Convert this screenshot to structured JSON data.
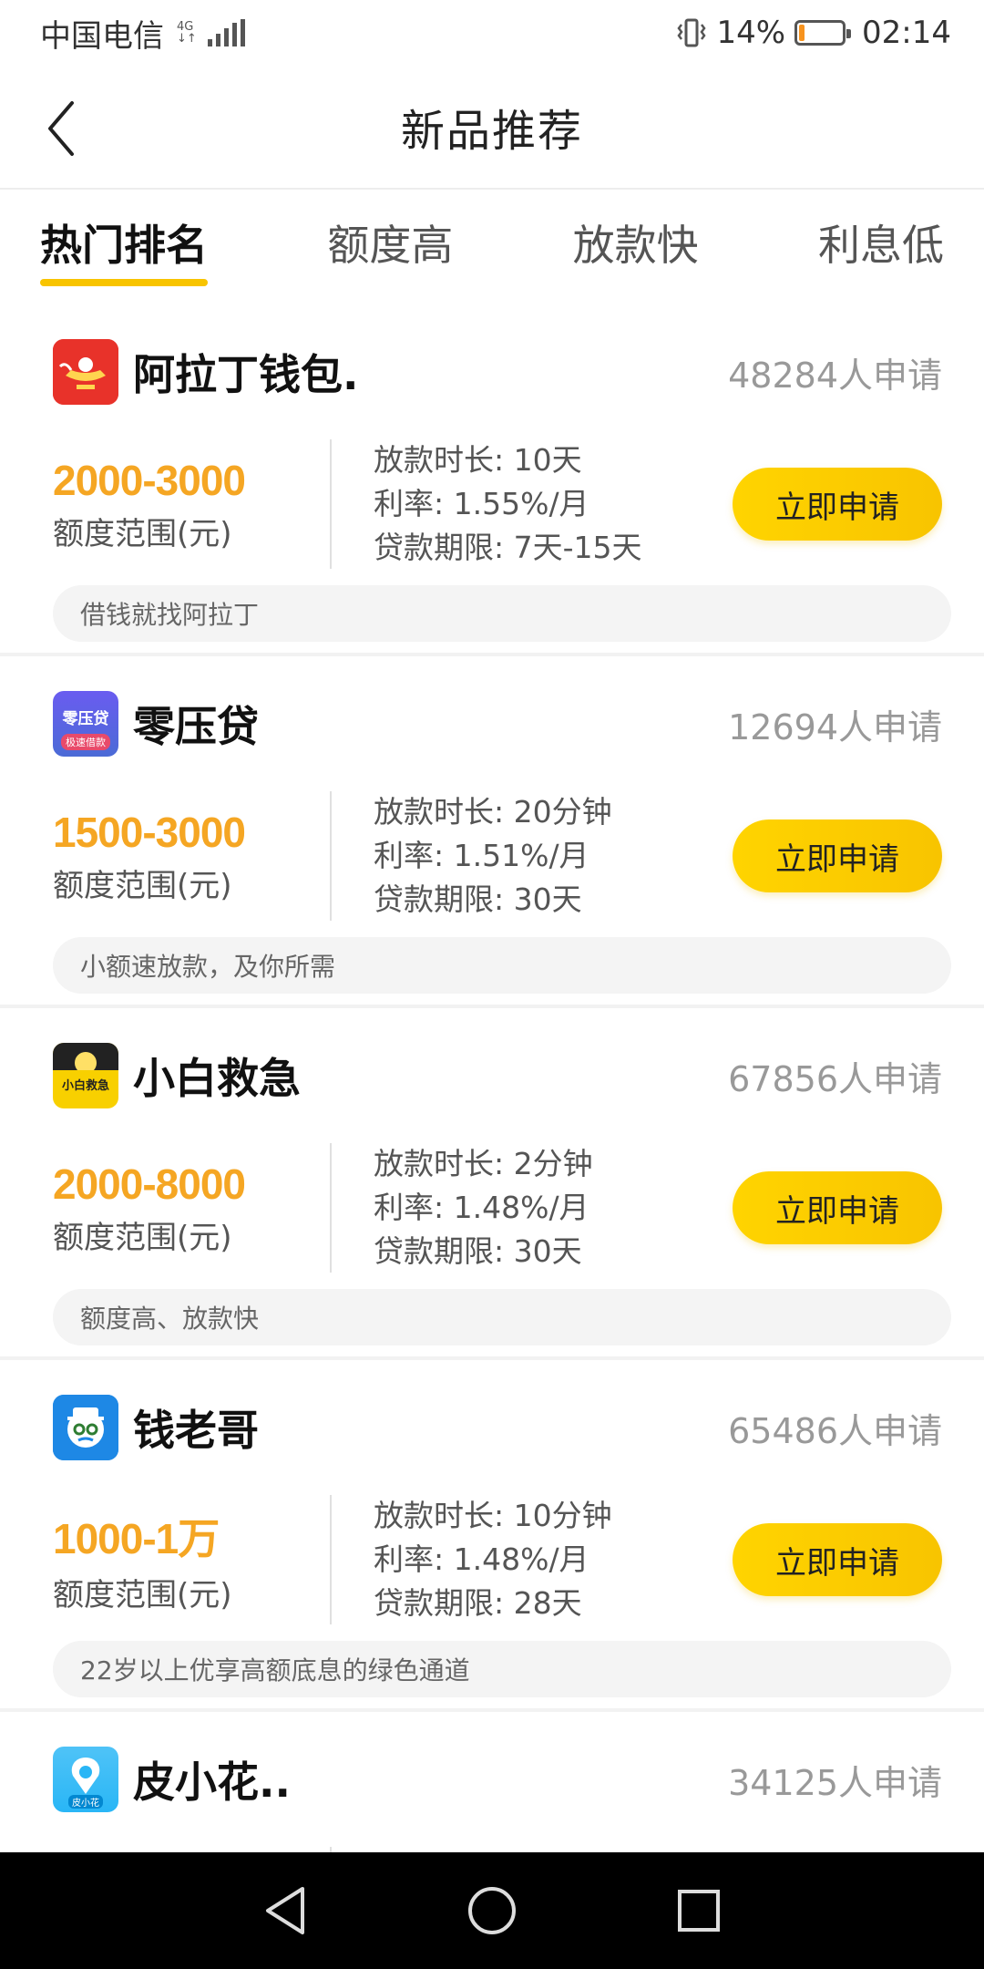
{
  "status_bar": {
    "carrier": "中国电信",
    "network": "4G",
    "battery_percent": "14%",
    "battery_level": 0.14,
    "time": "02:14"
  },
  "header": {
    "title": "新品推荐"
  },
  "tabs": [
    {
      "label": "热门排名",
      "active": true
    },
    {
      "label": "额度高",
      "active": false
    },
    {
      "label": "放款快",
      "active": false
    },
    {
      "label": "利息低",
      "active": false
    }
  ],
  "products": [
    {
      "name": "阿拉丁钱包.",
      "applicants": "48284人申请",
      "amount": "2000-3000",
      "amount_label": "额度范围(元)",
      "loan_time": "放款时长: 10天",
      "rate": "利率: 1.55%/月",
      "term": "贷款期限: 7天-15天",
      "button": "立即申请",
      "slogan": "借钱就找阿拉丁",
      "logo_color": "#e8322a"
    },
    {
      "name": "零压贷",
      "applicants": "12694人申请",
      "amount": "1500-3000",
      "amount_label": "额度范围(元)",
      "loan_time": "放款时长: 20分钟",
      "rate": "利率: 1.51%/月",
      "term": "贷款期限: 30天",
      "button": "立即申请",
      "slogan": "小额速放款，及你所需",
      "logo_color": "#5b5bd6",
      "logo_text": "零压贷",
      "logo_subtext": "极速借款"
    },
    {
      "name": "小白救急",
      "applicants": "67856人申请",
      "amount": "2000-8000",
      "amount_label": "额度范围(元)",
      "loan_time": "放款时长: 2分钟",
      "rate": "利率: 1.48%/月",
      "term": "贷款期限: 30天",
      "button": "立即申请",
      "slogan": "额度高、放款快",
      "logo_color": "#f8d000",
      "logo_text": "小白救急"
    },
    {
      "name": "钱老哥",
      "applicants": "65486人申请",
      "amount": "1000-1万",
      "amount_label": "额度范围(元)",
      "loan_time": "放款时长: 10分钟",
      "rate": "利率: 1.48%/月",
      "term": "贷款期限: 28天",
      "button": "立即申请",
      "slogan": "22岁以上优享高额底息的绿色通道",
      "logo_color": "#1e88e5"
    },
    {
      "name": "皮小花..",
      "applicants": "34125人申请",
      "logo_color": "#29b6f6",
      "logo_text": "皮小花"
    }
  ],
  "colors": {
    "accent": "#f8c400",
    "amount": "#f5a623"
  }
}
